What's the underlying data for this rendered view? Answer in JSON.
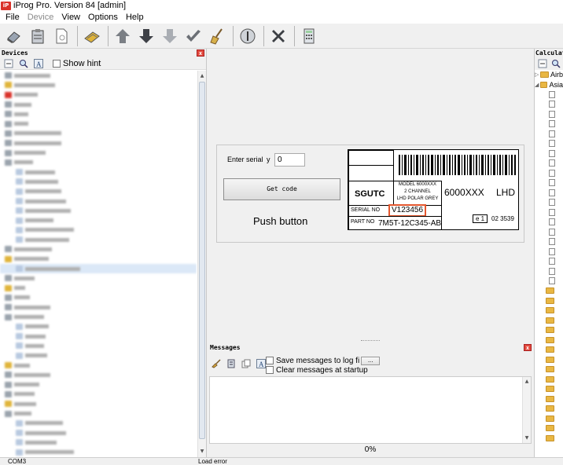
{
  "window": {
    "title": "iProg Pro. Version 84 [admin]",
    "icon_text": "iP"
  },
  "menu": [
    {
      "label": "File",
      "enabled": true
    },
    {
      "label": "Device",
      "enabled": false
    },
    {
      "label": "View",
      "enabled": true
    },
    {
      "label": "Options",
      "enabled": true
    },
    {
      "label": "Help",
      "enabled": true
    }
  ],
  "toolbar_icons": [
    "eraser-icon",
    "clipboard-icon",
    "document-icon",
    "chip-icon",
    "arrow-up-icon",
    "arrow-down-icon",
    "arrow-down-disabled-icon",
    "check-icon",
    "broom-icon",
    "info-circle-icon",
    "close-x-icon",
    "calculator-icon"
  ],
  "devices": {
    "title": "Devices",
    "show_hint": "Show hint"
  },
  "serial_panel": {
    "enter_serial_label": "Enter serial",
    "y_label": "y",
    "serial_value": "0",
    "get_code_label": "Get code",
    "push_button_label": "Push button"
  },
  "sticker": {
    "brand": "SGUTC",
    "model_line1": "MODEL 6000XXX",
    "model_line2": "2 CHANNEL",
    "model_line3": "LHD POLAR GREY",
    "model_code": "6000XXX",
    "lhd": "LHD",
    "serial_label": "SERIAL NO",
    "serial_value": "V123456",
    "part_label": "PART NO",
    "part_value": "7M5T-12C345-AB",
    "e_mark": "e 1",
    "approval": "02 3539",
    "highlight_color": "#e4572e"
  },
  "messages": {
    "title": "Messages",
    "save_label": "Save messages to log fi",
    "save_btn": "...",
    "clear_label": "Clear messages at startup",
    "progress": "0%"
  },
  "calculators": {
    "title": "Calculators",
    "rows": [
      "Airb",
      "Asia"
    ]
  },
  "status": {
    "port": "COM3",
    "load": "Load error"
  }
}
